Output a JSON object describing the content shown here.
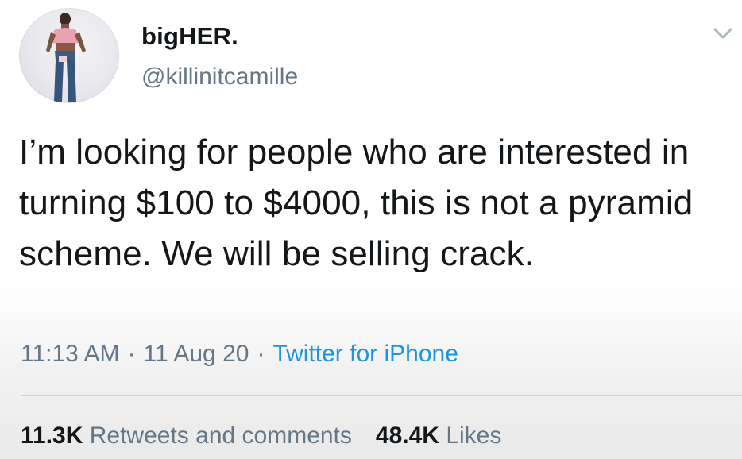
{
  "author": {
    "name": "bigHER.",
    "handle": "@killinitcamille"
  },
  "tweet": {
    "text": "I’m looking for people who are interested in turning $100 to $4000, this is not a pyramid scheme. We will be selling crack."
  },
  "meta": {
    "time": "11:13 AM",
    "separator": "·",
    "date": "11 Aug 20",
    "source": "Twitter for iPhone"
  },
  "stats": {
    "retweets_count": "11.3K",
    "retweets_label": "Retweets and comments",
    "likes_count": "48.4K",
    "likes_label": "Likes"
  },
  "icons": {
    "menu": "chevron-down-icon",
    "avatar": "avatar"
  },
  "colors": {
    "text": "#14171a",
    "secondary": "#657786",
    "link": "#1b95e0"
  }
}
